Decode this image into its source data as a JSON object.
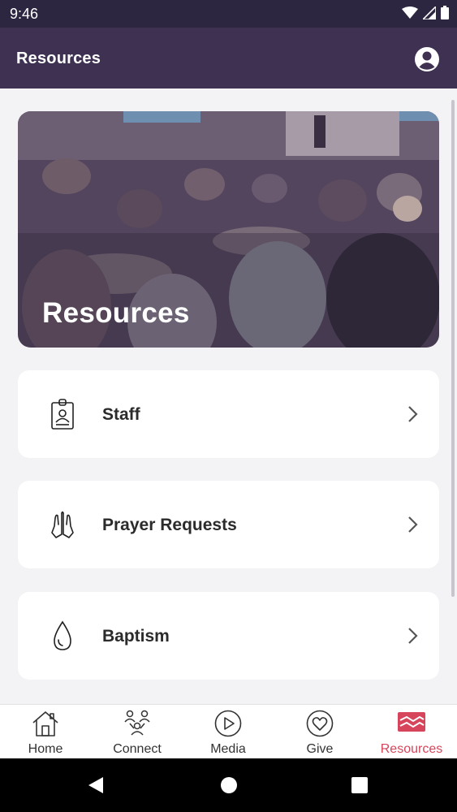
{
  "status_bar": {
    "time": "9:46"
  },
  "app_bar": {
    "title": "Resources"
  },
  "hero": {
    "title": "Resources"
  },
  "items": [
    {
      "label": "Staff",
      "icon": "staff-badge-icon"
    },
    {
      "label": "Prayer Requests",
      "icon": "praying-hands-icon"
    },
    {
      "label": "Baptism",
      "icon": "water-drop-icon"
    }
  ],
  "nav": {
    "home": "Home",
    "connect": "Connect",
    "media": "Media",
    "give": "Give",
    "resources": "Resources"
  },
  "colors": {
    "header": "#3f3152",
    "accent": "#d6455b",
    "background": "#f3f2f5"
  }
}
